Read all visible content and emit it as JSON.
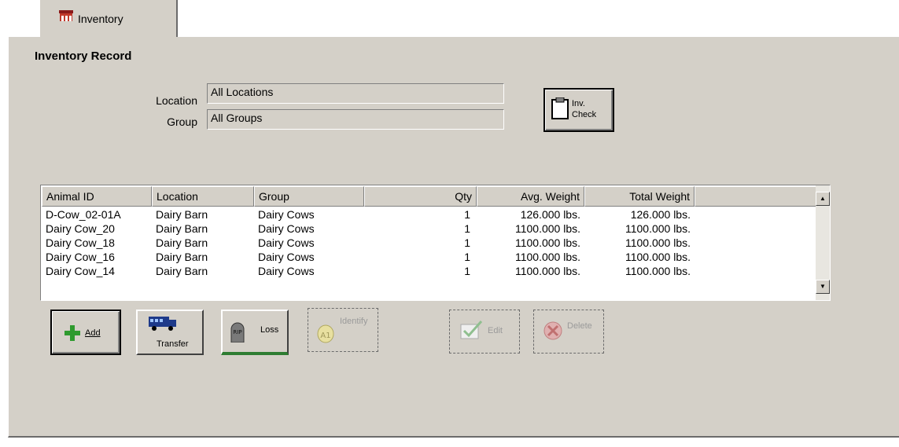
{
  "tab": {
    "label": "Inventory"
  },
  "section_title": "Inventory Record",
  "filters": {
    "location_label": "Location",
    "location_value": "All Locations",
    "group_label": "Group",
    "group_value": "All Groups"
  },
  "inv_check_button": {
    "line1": "Inv.",
    "line2": "Check"
  },
  "table": {
    "columns": [
      "Animal ID",
      "Location",
      "Group",
      "Qty",
      "Avg. Weight",
      "Total Weight"
    ],
    "rows": [
      [
        "D-Cow_02-01A",
        "Dairy Barn",
        "Dairy Cows",
        "1",
        "126.000 lbs.",
        "126.000 lbs."
      ],
      [
        "Dairy Cow_20",
        "Dairy Barn",
        "Dairy Cows",
        "1",
        "1100.000 lbs.",
        "1100.000 lbs."
      ],
      [
        "Dairy Cow_18",
        "Dairy Barn",
        "Dairy Cows",
        "1",
        "1100.000 lbs.",
        "1100.000 lbs."
      ],
      [
        "Dairy Cow_16",
        "Dairy Barn",
        "Dairy Cows",
        "1",
        "1100.000 lbs.",
        "1100.000 lbs."
      ],
      [
        "Dairy Cow_14",
        "Dairy Barn",
        "Dairy Cows",
        "1",
        "1100.000 lbs.",
        "1100.000 lbs."
      ]
    ]
  },
  "actions": {
    "add": "Add",
    "transfer": "Transfer",
    "loss": "Loss",
    "identify": "Identify",
    "edit": "Edit",
    "delete": "Delete"
  },
  "colors": {
    "panel": "#d4d0c8",
    "add_icon": "#2e9a2e",
    "transfer_icon": "#1e3a8a",
    "tab_icon": "#c0392b"
  }
}
